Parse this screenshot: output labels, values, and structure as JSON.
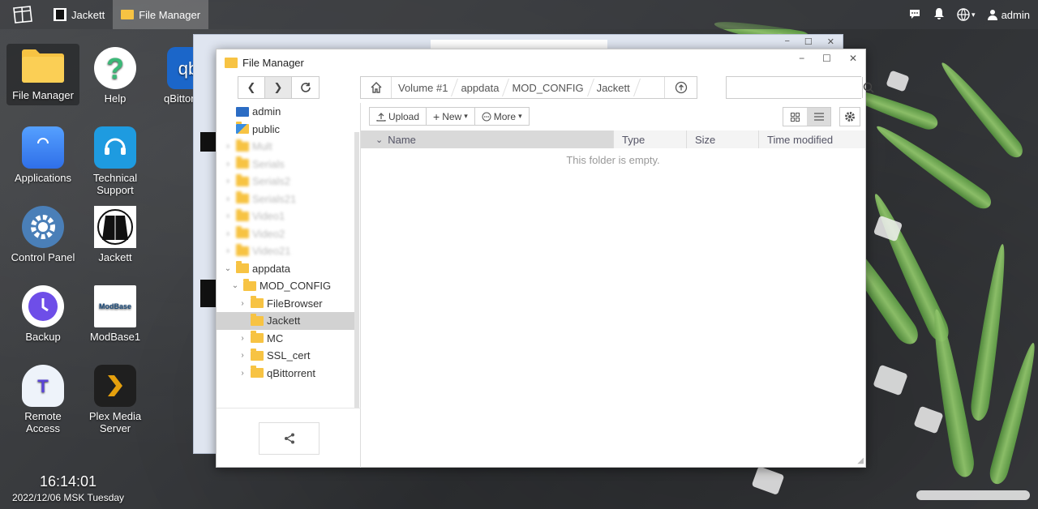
{
  "taskbar": {
    "apps": [
      {
        "label": "Jackett",
        "icon": "jackett-icon"
      },
      {
        "label": "File Manager",
        "icon": "folder-icon"
      }
    ],
    "user": "admin"
  },
  "desktop": {
    "icons": [
      {
        "label": "File Manager",
        "icon": "folder-icon"
      },
      {
        "label": "Help",
        "icon": "help-icon"
      },
      {
        "label": "qBittor",
        "icon": "qbittorrent-icon"
      },
      {
        "label": "Applications",
        "icon": "applications-icon"
      },
      {
        "label": "Technical Support",
        "icon": "headset-icon"
      },
      {
        "label": "Control Panel",
        "icon": "gear-icon"
      },
      {
        "label": "Jackett",
        "icon": "jackett-icon"
      },
      {
        "label": "Backup",
        "icon": "backup-icon"
      },
      {
        "label": "ModBase1",
        "icon": "modbase-icon"
      },
      {
        "label": "Remote Access",
        "icon": "cloud-icon"
      },
      {
        "label": "Plex Media Server",
        "icon": "plex-icon"
      }
    ],
    "clock": {
      "time": "16:14:01",
      "date": "2022/12/06 MSK Tuesday"
    }
  },
  "file_manager": {
    "title": "File Manager",
    "breadcrumb": [
      "Volume #1",
      "appdata",
      "MOD_CONFIG",
      "Jackett"
    ],
    "search_placeholder": "",
    "tree": [
      {
        "label": "admin",
        "level": 0,
        "arrow": "",
        "icon": "computer-icon",
        "blurred": false,
        "selected": false
      },
      {
        "label": "public",
        "level": 0,
        "arrow": "",
        "icon": "public-folder-icon",
        "blurred": false,
        "selected": false
      },
      {
        "label": "Mult",
        "level": 0,
        "arrow": "›",
        "icon": "folder-icon",
        "blurred": true,
        "selected": false
      },
      {
        "label": "Serials",
        "level": 0,
        "arrow": "›",
        "icon": "folder-icon",
        "blurred": true,
        "selected": false
      },
      {
        "label": "Serials2",
        "level": 0,
        "arrow": "›",
        "icon": "folder-icon",
        "blurred": true,
        "selected": false
      },
      {
        "label": "Serials21",
        "level": 0,
        "arrow": "›",
        "icon": "folder-icon",
        "blurred": true,
        "selected": false
      },
      {
        "label": "Video1",
        "level": 0,
        "arrow": "›",
        "icon": "folder-icon",
        "blurred": true,
        "selected": false
      },
      {
        "label": "Video2",
        "level": 0,
        "arrow": "›",
        "icon": "folder-icon",
        "blurred": true,
        "selected": false
      },
      {
        "label": "Video21",
        "level": 0,
        "arrow": "›",
        "icon": "folder-icon",
        "blurred": true,
        "selected": false
      },
      {
        "label": "appdata",
        "level": 0,
        "arrow": "⌄",
        "icon": "folder-icon",
        "blurred": false,
        "selected": false
      },
      {
        "label": "MOD_CONFIG",
        "level": 1,
        "arrow": "⌄",
        "icon": "folder-icon",
        "blurred": false,
        "selected": false
      },
      {
        "label": "FileBrowser",
        "level": 2,
        "arrow": "›",
        "icon": "folder-icon",
        "blurred": false,
        "selected": false
      },
      {
        "label": "Jackett",
        "level": 2,
        "arrow": "",
        "icon": "folder-icon",
        "blurred": false,
        "selected": true
      },
      {
        "label": "MC",
        "level": 2,
        "arrow": "›",
        "icon": "folder-icon",
        "blurred": false,
        "selected": false
      },
      {
        "label": "SSL_cert",
        "level": 2,
        "arrow": "›",
        "icon": "folder-icon",
        "blurred": false,
        "selected": false
      },
      {
        "label": "qBittorrent",
        "level": 2,
        "arrow": "›",
        "icon": "folder-icon",
        "blurred": false,
        "selected": false
      }
    ],
    "actions": {
      "upload": "Upload",
      "new": "New",
      "more": "More"
    },
    "columns": {
      "name": "Name",
      "type": "Type",
      "size": "Size",
      "time": "Time modified"
    },
    "empty_message": "This folder is empty."
  }
}
